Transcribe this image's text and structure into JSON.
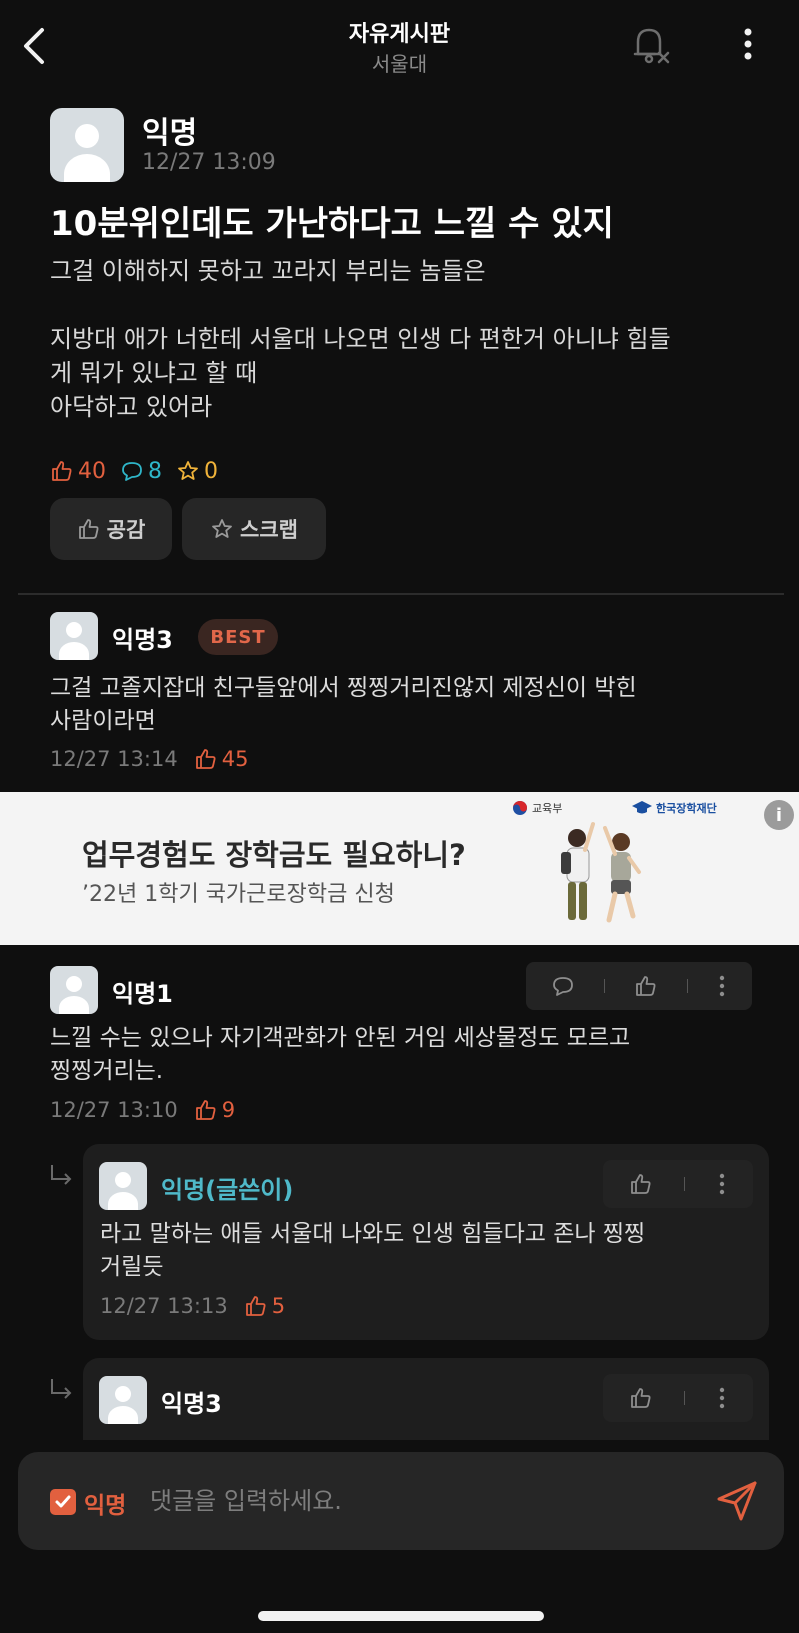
{
  "header": {
    "title": "자유게시판",
    "subtitle": "서울대"
  },
  "post": {
    "author": "익명",
    "time": "12/27 13:09",
    "title": "10분위인데도 가난하다고 느낄 수 있지",
    "body": "그걸 이해하지 못하고 꼬라지 부리는 놈들은\n\n지방대 애가 너한테 서울대 나오면 인생 다 편한거 아니냐 힘들\n게 뭐가 있냐고 할 때\n아닥하고 있어라",
    "likes": "40",
    "comments": "8",
    "scraps": "0",
    "like_button": "공감",
    "scrap_button": "스크랩"
  },
  "comments": [
    {
      "author": "익명3",
      "badge": "BEST",
      "text": "그걸 고졸지잡대 친구들앞에서 찡찡거리진않지 제정신이 박힌\n사람이라면",
      "time": "12/27 13:14",
      "likes": "45"
    },
    {
      "author": "익명1",
      "text": "느낄 수는 있으나 자기객관화가 안된 거임 세상물정도 모르고\n찡찡거리는.",
      "time": "12/27 13:10",
      "likes": "9"
    },
    {
      "author": "익명(글쓴이)",
      "text": "라고 말하는 애들 서울대 나와도 인생 힘들다고 존나 찡찡\n거릴듯",
      "time": "12/27 13:13",
      "likes": "5"
    },
    {
      "author": "익명3"
    }
  ],
  "ad": {
    "title": "업무경험도 장학금도 필요하니?",
    "subtitle": "’22년 1학기 국가근로장학금 신청",
    "logo_ministry": "교육부",
    "logo_foundation": "한국장학재단",
    "info_icon": "i"
  },
  "input": {
    "anon_label": "익명",
    "placeholder": "댓글을 입력하세요."
  },
  "colors": {
    "accent": "#e2603f",
    "comment": "#2fb6c9",
    "scrap": "#f0b33a",
    "op": "#4fb9c9",
    "background": "#0f0f0f"
  }
}
